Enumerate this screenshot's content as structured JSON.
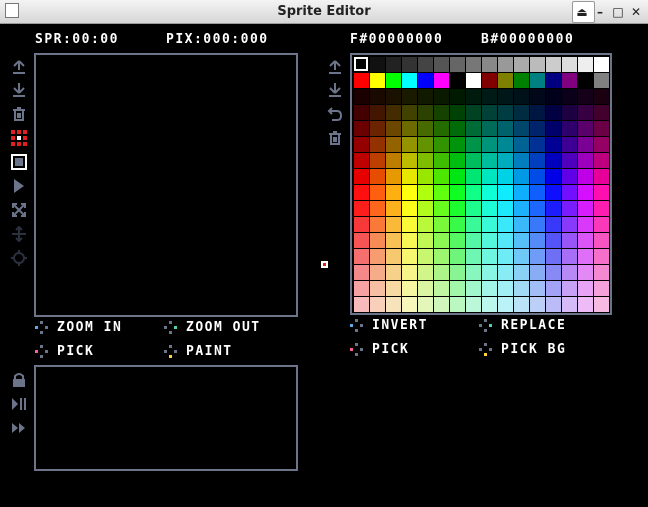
{
  "window": {
    "title": "Sprite Editor"
  },
  "status": {
    "sprite": "SPR:00:00",
    "pixel": "PIX:000:000",
    "fg": "F#00000000",
    "bg": "B#00000000"
  },
  "hints": {
    "zoom_in": "ZOOM IN",
    "zoom_out": "ZOOM OUT",
    "pick": "PICK",
    "paint": "PAINT",
    "invert": "INVERT",
    "replace": "REPLACE",
    "pick_color": "PICK",
    "pick_bg": "PICK BG"
  },
  "left_tools": [
    "upload-icon",
    "download-icon",
    "trash-icon",
    "grid-icon",
    "square-icon",
    "play-icon",
    "shuffle-icon",
    "move-icon",
    "crosshair-icon"
  ],
  "anim_tools": [
    "lock-icon",
    "play-pause-icon",
    "fast-forward-icon"
  ],
  "palette_tools": [
    "upload-icon",
    "download-icon",
    "undo-icon",
    "trash-icon"
  ],
  "palette": {
    "columns": 16,
    "rows": 16,
    "top_rows": [
      [
        "#000000",
        "#111111",
        "#222222",
        "#333333",
        "#444444",
        "#555555",
        "#666666",
        "#777777",
        "#888888",
        "#999999",
        "#aaaaaa",
        "#bbbbbb",
        "#cccccc",
        "#dddddd",
        "#eeeeee",
        "#ffffff"
      ],
      [
        "#ff0000",
        "#ffff00",
        "#00ff00",
        "#00ffff",
        "#0000ff",
        "#ff00ff",
        "#000000",
        "#ffffff",
        "#800000",
        "#808000",
        "#008000",
        "#008080",
        "#000080",
        "#800080",
        "#000000",
        "#808080"
      ]
    ]
  },
  "colors": {
    "panel_border": "#6b7488",
    "hint_blue": "#5da9e9",
    "hint_teal": "#4fd1b2",
    "hint_pink": "#ff5f9e",
    "hint_yellow": "#ffd23f"
  }
}
